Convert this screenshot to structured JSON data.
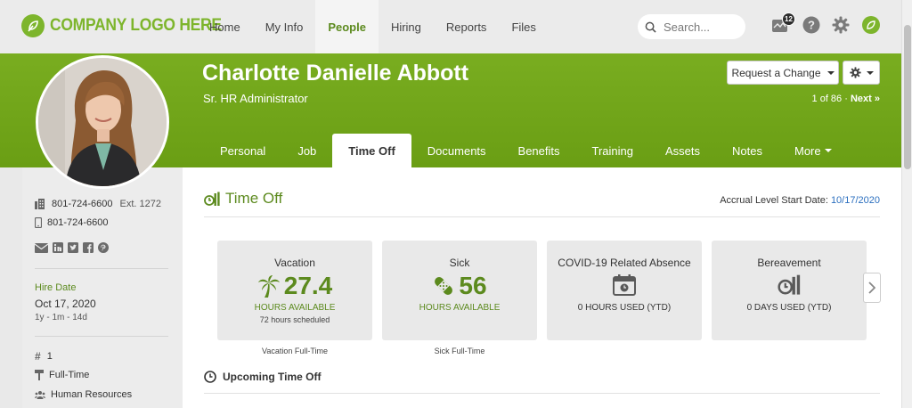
{
  "topbar": {
    "logo_text": "COMPANY LOGO HERE",
    "nav": [
      "Home",
      "My Info",
      "People",
      "Hiring",
      "Reports",
      "Files"
    ],
    "active_nav": "People",
    "search_placeholder": "Search...",
    "notification_count": "12",
    "colors": {
      "brand": "#7db52c",
      "active_nav_text": "#5c8a1e"
    }
  },
  "header": {
    "name": "Charlotte Danielle Abbott",
    "job_title": "Sr. HR Administrator",
    "request_button": "Request a Change",
    "paging": "1 of 86",
    "next_label": "Next",
    "tabs": [
      "Personal",
      "Job",
      "Time Off",
      "Documents",
      "Benefits",
      "Training",
      "Assets",
      "Notes",
      "More"
    ],
    "active_tab": "Time Off",
    "colors": {
      "header_bg": "#74a81b"
    }
  },
  "sidebar": {
    "work_phone": "801-724-6600",
    "extension": "Ext. 1272",
    "mobile_phone": "801-724-6600",
    "social_icons": [
      "email-icon",
      "linkedin-icon",
      "twitter-icon",
      "facebook-icon",
      "pinterest-icon"
    ],
    "hire_date_label": "Hire Date",
    "hire_date": "Oct 17, 2020",
    "hire_duration": "1y - 1m - 14d",
    "employee_number": "1",
    "employment_status": "Full-Time",
    "department": "Human Resources"
  },
  "time_off": {
    "title": "Time Off",
    "accrual_label": "Accrual Level Start Date:",
    "accrual_date": "10/17/2020",
    "cards": [
      {
        "title": "Vacation",
        "value": "27.4",
        "sub": "HOURS AVAILABLE",
        "note": "72 hours scheduled",
        "caption": "Vacation Full-Time",
        "icon": "palm-tree-icon"
      },
      {
        "title": "Sick",
        "value": "56",
        "sub": "HOURS AVAILABLE",
        "note": "",
        "caption": "Sick Full-Time",
        "icon": "bandage-icon"
      },
      {
        "title": "COVID-19 Related Absence",
        "value": "",
        "sub": "0 HOURS USED (YTD)",
        "note": "",
        "caption": "",
        "icon": "calendar-clock-icon"
      },
      {
        "title": "Bereavement",
        "value": "",
        "sub": "0 DAYS USED (YTD)",
        "note": "",
        "caption": "",
        "icon": "time-off-icon"
      }
    ],
    "upcoming_title": "Upcoming Time Off"
  }
}
